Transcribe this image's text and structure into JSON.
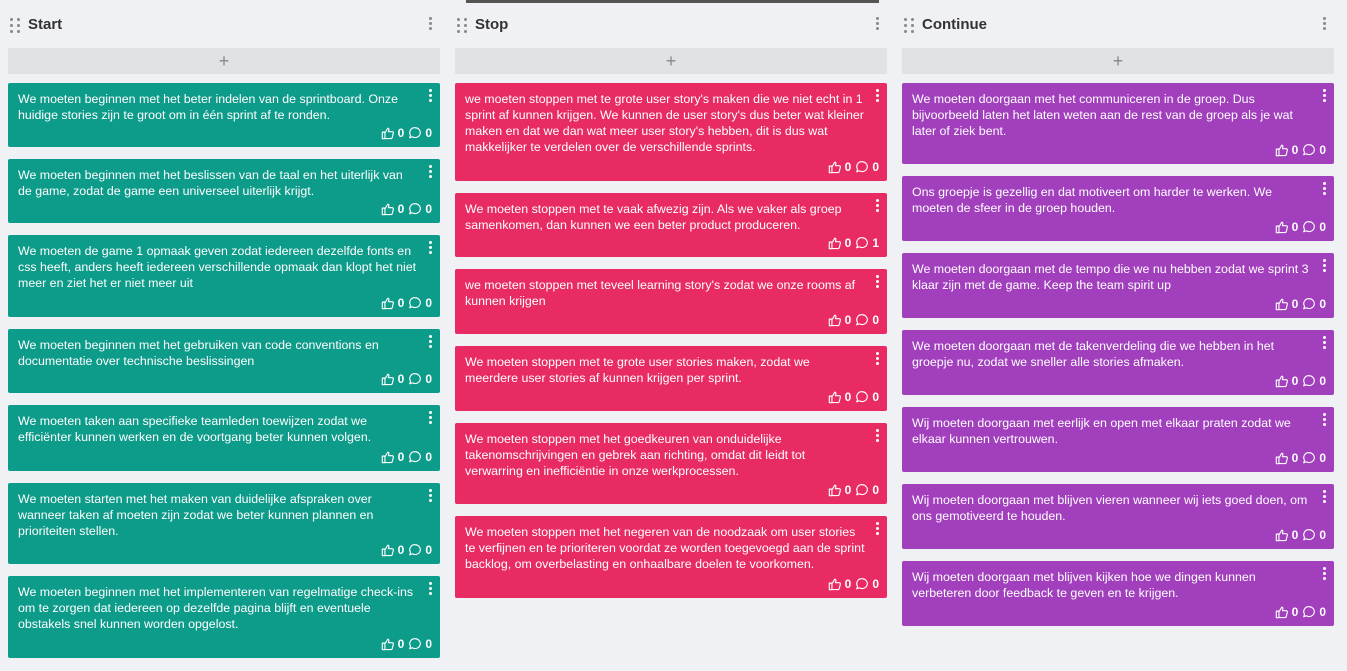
{
  "columns": [
    {
      "title": "Start",
      "add_label": "+",
      "color": "#0d9b8a",
      "cards": [
        {
          "text": "We moeten beginnen met het beter indelen van de sprintboard. Onze huidige stories zijn te groot om in één sprint af te ronden.",
          "likes": "0",
          "comments": "0"
        },
        {
          "text": "We moeten beginnen met het beslissen van de taal en het uiterlijk van de game, zodat de game een universeel uiterlijk krijgt.",
          "likes": "0",
          "comments": "0"
        },
        {
          "text": "We moeten de game 1 opmaak geven zodat iedereen dezelfde fonts en css heeft, anders heeft iedereen verschillende opmaak dan klopt het niet meer en ziet het er niet meer uit",
          "likes": "0",
          "comments": "0"
        },
        {
          "text": "We moeten beginnen met het gebruiken van code conventions en documentatie over technische beslissingen",
          "likes": "0",
          "comments": "0"
        },
        {
          "text": "We moeten taken aan specifieke teamleden toewijzen zodat we efficiënter kunnen werken en de voortgang beter kunnen volgen.",
          "likes": "0",
          "comments": "0"
        },
        {
          "text": "We moeten starten met het maken van duidelijke afspraken over wanneer taken af moeten zijn zodat we beter kunnen plannen en prioriteiten stellen.",
          "likes": "0",
          "comments": "0"
        },
        {
          "text": "We moeten beginnen met het implementeren van regelmatige check-ins om te zorgen dat iedereen op dezelfde pagina blijft en eventuele obstakels snel kunnen worden opgelost.",
          "likes": "0",
          "comments": "0"
        }
      ]
    },
    {
      "title": "Stop",
      "add_label": "+",
      "color": "#e82b63",
      "cards": [
        {
          "text": "we moeten stoppen met te grote user story's maken die we niet echt in 1 sprint af kunnen krijgen. We kunnen de user story's dus beter wat kleiner maken en dat we dan wat meer user story's hebben, dit is dus wat makkelijker te verdelen over de verschillende sprints.",
          "likes": "0",
          "comments": "0"
        },
        {
          "text": "We moeten stoppen met te vaak afwezig zijn. Als we vaker als groep samenkomen, dan kunnen we een beter product produceren.",
          "likes": "0",
          "comments": "1"
        },
        {
          "text": "we moeten stoppen met teveel learning story's zodat we onze rooms af kunnen krijgen",
          "likes": "0",
          "comments": "0"
        },
        {
          "text": "We moeten stoppen met te grote user stories maken, zodat we meerdere user stories af kunnen krijgen per sprint.",
          "likes": "0",
          "comments": "0"
        },
        {
          "text": "We moeten stoppen met het goedkeuren van onduidelijke takenomschrijvingen en gebrek aan richting, omdat dit leidt tot verwarring en inefficiëntie in onze werkprocessen.",
          "likes": "0",
          "comments": "0"
        },
        {
          "text": "We moeten stoppen met het negeren van de noodzaak om user stories te verfijnen en te prioriteren voordat ze worden toegevoegd aan de sprint backlog, om overbelasting en onhaalbare doelen te voorkomen.",
          "likes": "0",
          "comments": "0"
        }
      ]
    },
    {
      "title": "Continue",
      "add_label": "+",
      "color": "#a13fbd",
      "cards": [
        {
          "text": "We moeten doorgaan met het communiceren in de groep. Dus bijvoorbeeld laten het laten weten aan de rest van de groep als je wat later of ziek bent.",
          "likes": "0",
          "comments": "0"
        },
        {
          "text": "Ons groepje is gezellig en dat motiveert om harder te werken. We moeten de sfeer in de groep houden.",
          "likes": "0",
          "comments": "0"
        },
        {
          "text": "We moeten doorgaan met de tempo die we nu hebben zodat we sprint 3 klaar zijn met de game. Keep the team spirit up",
          "likes": "0",
          "comments": "0"
        },
        {
          "text": "We moeten doorgaan met de takenverdeling die we hebben in het groepje nu, zodat we sneller alle stories afmaken.",
          "likes": "0",
          "comments": "0"
        },
        {
          "text": "Wij moeten doorgaan met eerlijk en open met elkaar praten zodat we elkaar kunnen vertrouwen.",
          "likes": "0",
          "comments": "0"
        },
        {
          "text": "Wij moeten doorgaan met blijven vieren wanneer wij iets goed doen, om ons gemotiveerd te houden.",
          "likes": "0",
          "comments": "0"
        },
        {
          "text": "Wij moeten doorgaan met blijven kijken hoe we dingen kunnen verbeteren door feedback te geven en te krijgen.",
          "likes": "0",
          "comments": "0"
        }
      ]
    }
  ]
}
